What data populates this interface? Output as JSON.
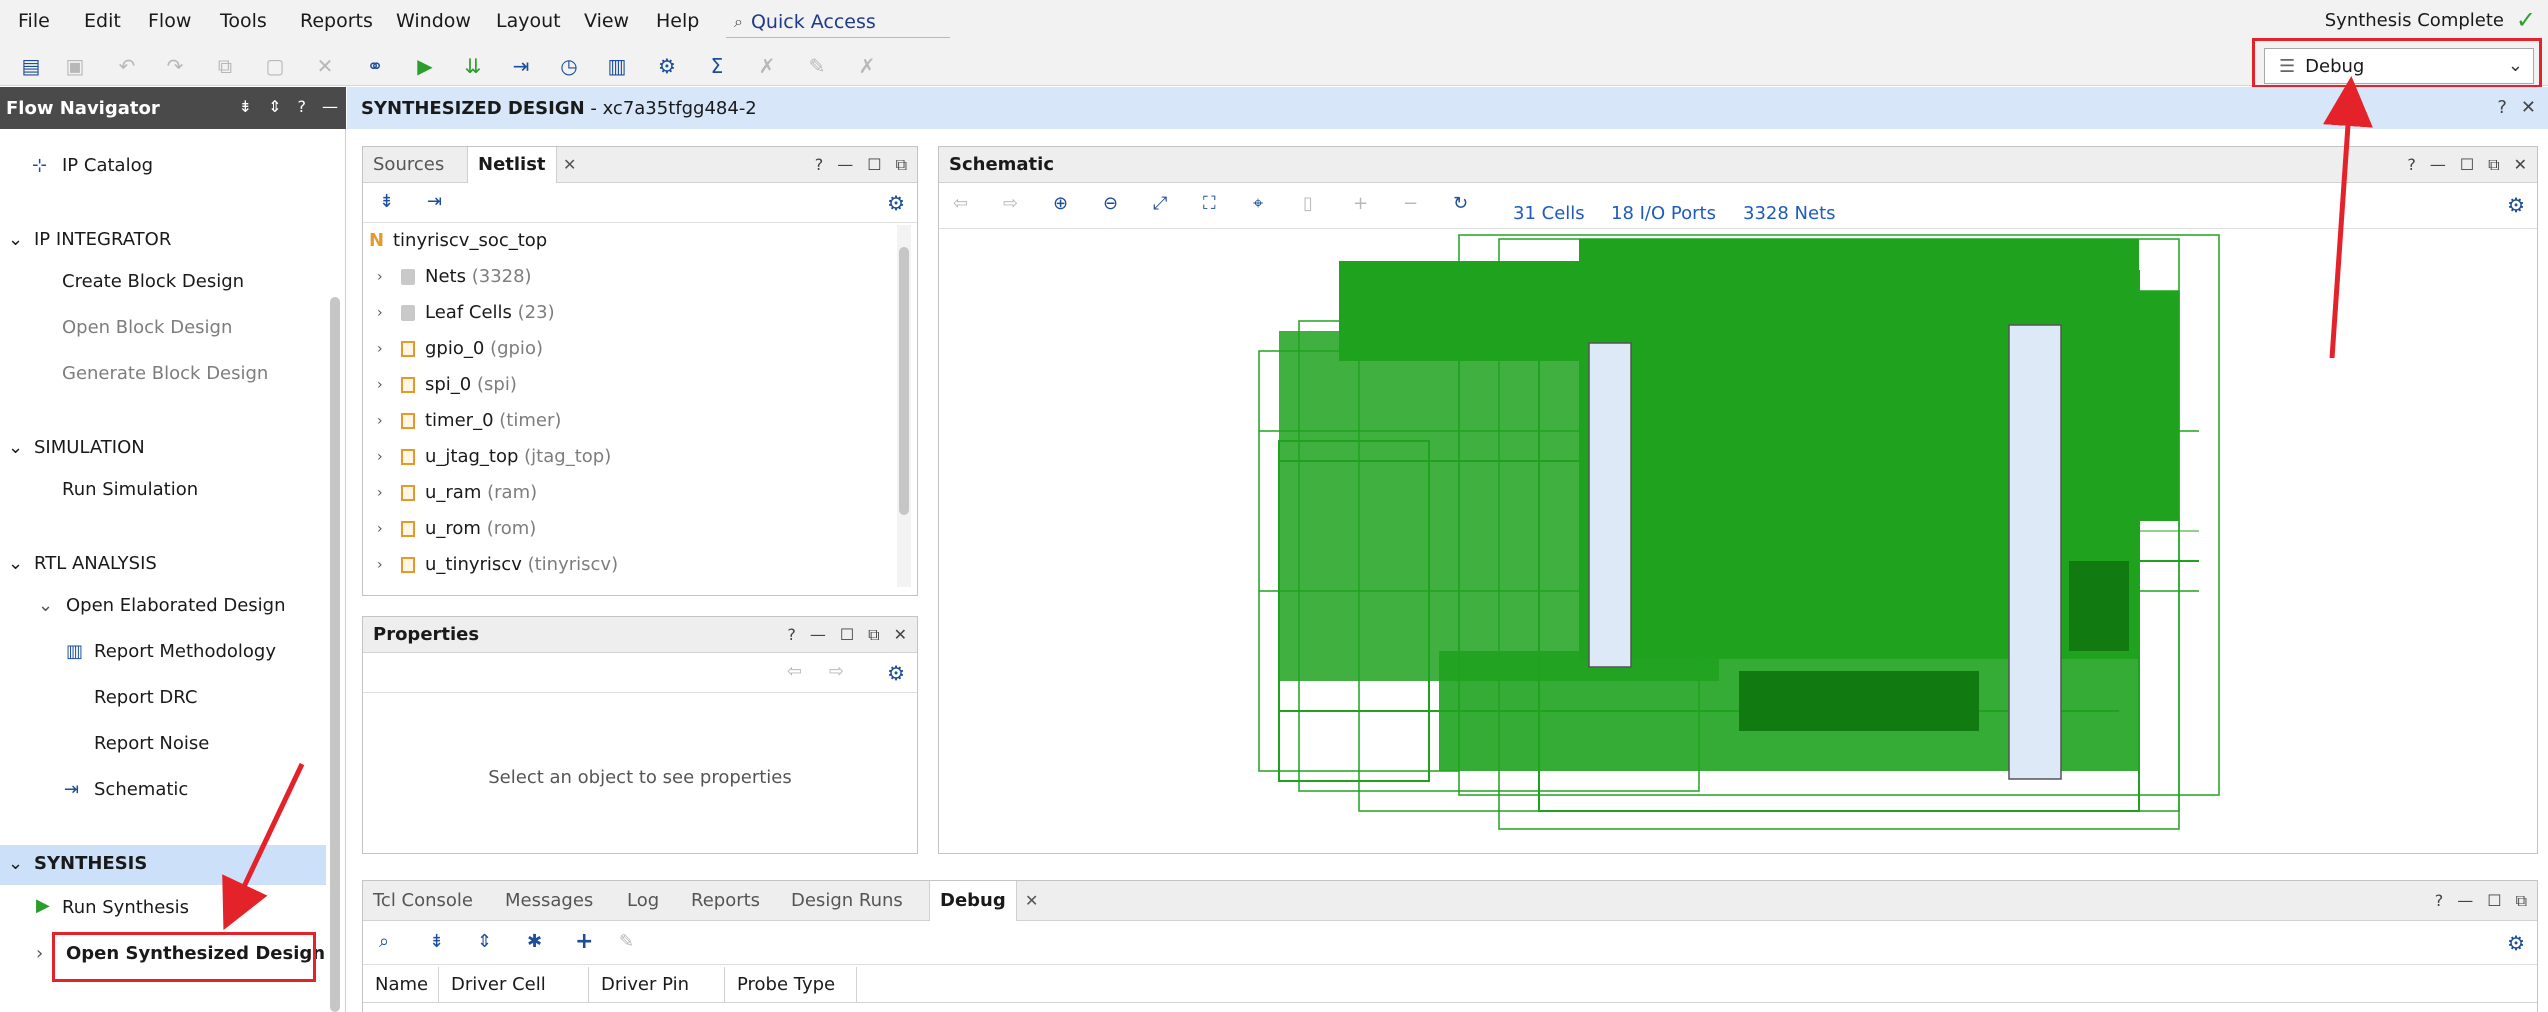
{
  "menubar": {
    "items": [
      "File",
      "Edit",
      "Flow",
      "Tools",
      "Reports",
      "Window",
      "Layout",
      "View",
      "Help"
    ],
    "quick_access": "Quick Access",
    "status": "Synthesis Complete"
  },
  "layout_select": {
    "value": "Debug"
  },
  "flow_navigator": {
    "title": "Flow Navigator",
    "ip_catalog": "IP Catalog",
    "sections": {
      "ip_integrator": {
        "label": "IP INTEGRATOR",
        "items": [
          "Create Block Design",
          "Open Block Design",
          "Generate Block Design"
        ]
      },
      "simulation": {
        "label": "SIMULATION",
        "items": [
          "Run Simulation"
        ]
      },
      "rtl_analysis": {
        "label": "RTL ANALYSIS",
        "open_elaborated": "Open Elaborated Design",
        "items": [
          "Report Methodology",
          "Report DRC",
          "Report Noise",
          "Schematic"
        ]
      },
      "synthesis": {
        "label": "SYNTHESIS",
        "run": "Run Synthesis",
        "open": "Open Synthesized Design"
      }
    }
  },
  "design_bar": {
    "title": "SYNTHESIZED DESIGN",
    "part": " - xc7a35tfgg484-2"
  },
  "sources_panel": {
    "tabs": [
      "Sources",
      "Netlist"
    ],
    "top": "tinyriscv_soc_top",
    "rows": [
      {
        "name": "Nets",
        "meta": "(3328)",
        "kind": "folder"
      },
      {
        "name": "Leaf Cells",
        "meta": "(23)",
        "kind": "folder"
      },
      {
        "name": "gpio_0",
        "meta": "(gpio)",
        "kind": "cell"
      },
      {
        "name": "spi_0",
        "meta": "(spi)",
        "kind": "cell"
      },
      {
        "name": "timer_0",
        "meta": "(timer)",
        "kind": "cell"
      },
      {
        "name": "u_jtag_top",
        "meta": "(jtag_top)",
        "kind": "cell"
      },
      {
        "name": "u_ram",
        "meta": "(ram)",
        "kind": "cell"
      },
      {
        "name": "u_rom",
        "meta": "(rom)",
        "kind": "cell"
      },
      {
        "name": "u_tinyriscv",
        "meta": "(tinyriscv)",
        "kind": "cell"
      }
    ]
  },
  "properties_panel": {
    "title": "Properties",
    "empty_message": "Select an object to see properties"
  },
  "schematic_panel": {
    "title": "Schematic",
    "cells": "31 Cells",
    "ports": "18 I/O Ports",
    "nets": "3328 Nets"
  },
  "bottom_panel": {
    "tabs": [
      "Tcl Console",
      "Messages",
      "Log",
      "Reports",
      "Design Runs",
      "Debug"
    ],
    "columns": [
      "Name",
      "Driver Cell",
      "Driver Pin",
      "Probe Type"
    ]
  },
  "colors": {
    "accent": "#1e5bbf",
    "highlight_annotation": "#e3222a",
    "wire_green": "#1fa31f"
  }
}
